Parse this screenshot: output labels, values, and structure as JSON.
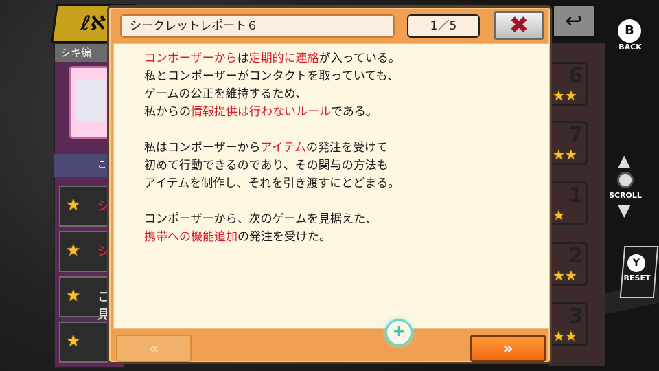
{
  "background": {
    "title_glyph": "ℓℵ",
    "tab_label": "シキ編",
    "header_strip_text": "こ",
    "rows": [
      {
        "star": "★",
        "text": "シ"
      },
      {
        "star": "★",
        "text": "シ"
      },
      {
        "star": "★",
        "text": "こ見"
      },
      {
        "star": "★",
        "text": ""
      }
    ],
    "day_cards": [
      {
        "num": "6",
        "stars": "★★",
        "color": "#e98bd0"
      },
      {
        "num": "7",
        "stars": "★★",
        "color": "#c65ac0"
      },
      {
        "num": "1",
        "stars": "★",
        "color": "#2ec1d1"
      },
      {
        "num": "2",
        "stars": "★★",
        "color": "#2ec1d1"
      },
      {
        "num": "3",
        "stars": "★★",
        "color": "#2ec1d1"
      }
    ],
    "back_arrow": "↩"
  },
  "controls": {
    "back_button": "B",
    "back_label": "BACK",
    "scroll_label": "SCROLL",
    "reset_button": "Y",
    "reset_label": "RESET"
  },
  "modal": {
    "title": "シークレットレポート６",
    "page": "1／5",
    "close_icon": "✖",
    "paragraphs": [
      [
        [
          {
            "t": "コンポーザーから",
            "h": true
          },
          {
            "t": "は",
            "h": false
          },
          {
            "t": "定期的に連絡",
            "h": true
          },
          {
            "t": "が入っている。",
            "h": false
          }
        ],
        [
          {
            "t": "私とコンポーザーがコンタクトを取っていても、",
            "h": false
          }
        ],
        [
          {
            "t": "ゲームの公正を維持するため、",
            "h": false
          }
        ],
        [
          {
            "t": "私からの",
            "h": false
          },
          {
            "t": "情報提供は行わないルール",
            "h": true
          },
          {
            "t": "である。",
            "h": false
          }
        ]
      ],
      [
        [
          {
            "t": "私はコンポーザーから",
            "h": false
          },
          {
            "t": "アイテム",
            "h": true
          },
          {
            "t": "の発注を受けて",
            "h": false
          }
        ],
        [
          {
            "t": "初めて行動できるのであり、その関与の方法も",
            "h": false
          }
        ],
        [
          {
            "t": "アイテムを制作し、それを引き渡すにとどまる。",
            "h": false
          }
        ]
      ],
      [
        [
          {
            "t": "コンポーザーから、次のゲームを見据えた、",
            "h": false
          }
        ],
        [
          {
            "t": "携帯への機能追加",
            "h": true
          },
          {
            "t": "の発注を受けた。",
            "h": false
          }
        ]
      ]
    ],
    "zoom_icon": "+",
    "prev_label": "«",
    "next_label": "»"
  }
}
